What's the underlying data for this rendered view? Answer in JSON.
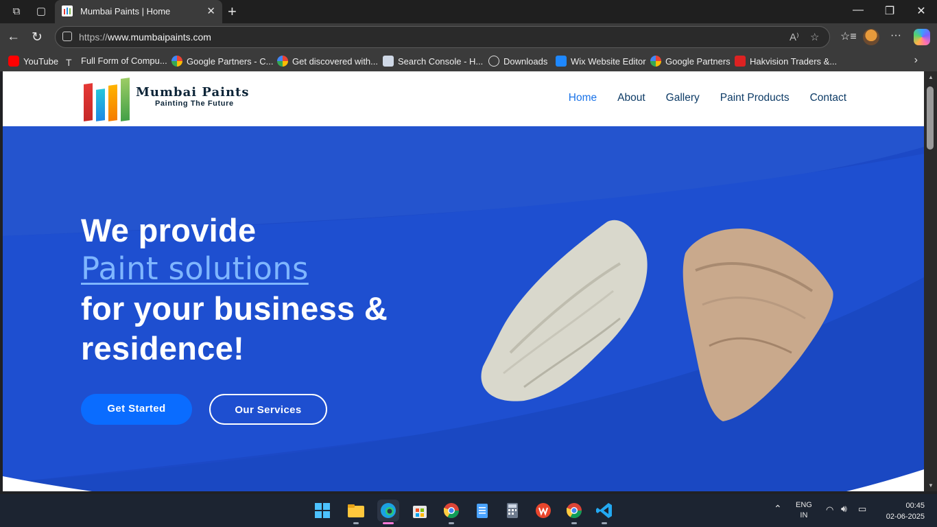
{
  "browser": {
    "tab_title": "Mumbai Paints | Home",
    "url_prefix": "https://",
    "url_host": "www.mumbaipaints.com",
    "reader_label": "A⁾"
  },
  "bookmarks": [
    {
      "label": "YouTube",
      "icon": "youtube-icon",
      "color": "#ff0000"
    },
    {
      "label": "Full Form of Compu...",
      "icon": "text-icon",
      "color": "#3b3b3b"
    },
    {
      "label": "Google Partners - C...",
      "icon": "google-icon",
      "color": "#ffffff"
    },
    {
      "label": "Get discovered with...",
      "icon": "google-icon",
      "color": "#ffffff"
    },
    {
      "label": "Search Console - H...",
      "icon": "search-console-icon",
      "color": "#cfd8e6"
    },
    {
      "label": "Downloads",
      "icon": "globe-icon",
      "color": "#3b3b3b"
    },
    {
      "label": "Wix Website Editor",
      "icon": "wix-icon",
      "color": "#1e88ff"
    },
    {
      "label": "Google Partners",
      "icon": "google-icon",
      "color": "#ffffff"
    },
    {
      "label": "Hakvision Traders &...",
      "icon": "m-logo-icon",
      "color": "#d22"
    }
  ],
  "site": {
    "brand": "Mumbai Paints",
    "tagline": "Painting The Future",
    "nav": [
      "Home",
      "About",
      "Gallery",
      "Paint Products",
      "Contact"
    ],
    "hero": {
      "line1": "We provide",
      "line2": "Paint solutions",
      "line3": "for your business &",
      "line4": "residence!",
      "cta_primary": "Get Started",
      "cta_secondary": "Our Services"
    }
  },
  "taskbar": {
    "lang_top": "ENG",
    "lang_bottom": "IN",
    "time": "00:45",
    "date": "02-06-2025"
  },
  "colors": {
    "hero_bg": "#1c49c6",
    "accent": "#0a6cff",
    "nav_text": "#0d3b66",
    "nav_active": "#1a73e8"
  }
}
